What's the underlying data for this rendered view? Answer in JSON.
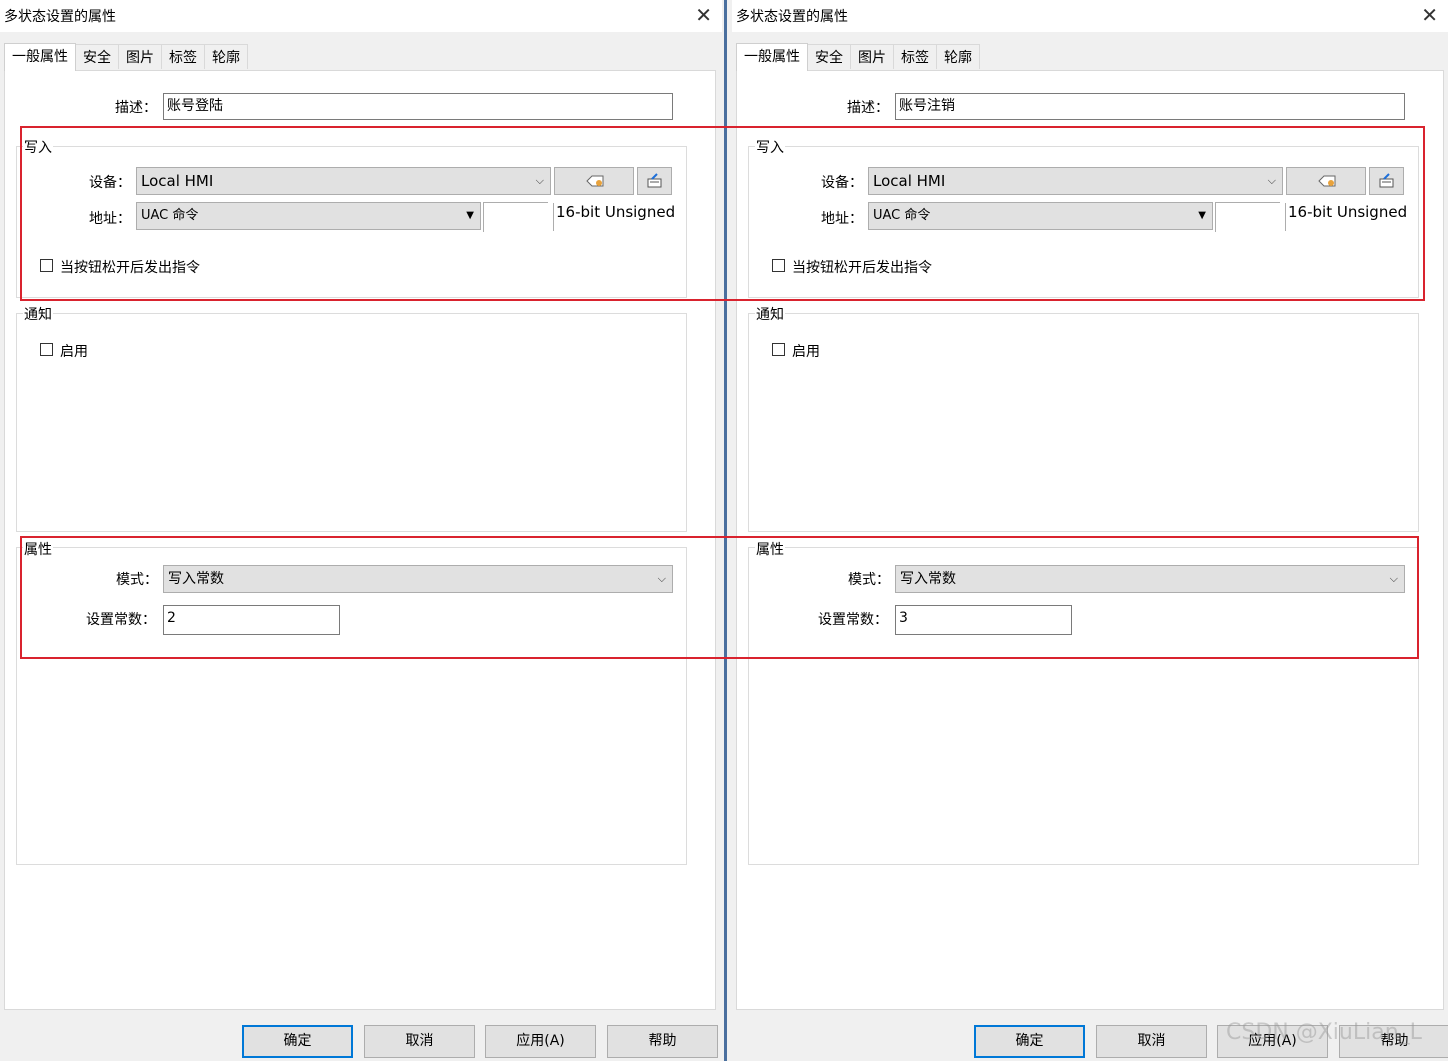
{
  "dialogs": [
    {
      "title": "多状态设置的属性",
      "tabs": [
        "一般属性",
        "安全",
        "图片",
        "标签",
        "轮廓"
      ],
      "desc_label": "描述：",
      "desc_value": "账号登陆",
      "write_group": "写入",
      "device_label": "设备：",
      "device_value": "Local HMI",
      "address_label": "地址：",
      "address_value": "UAC 命令",
      "address_offset": "",
      "data_type": "16-bit Unsigned",
      "release_checkbox": "当按钮松开后发出指令",
      "notify_group": "通知",
      "enable_checkbox": "启用",
      "attr_group": "属性",
      "mode_label": "模式：",
      "mode_value": "写入常数",
      "const_label": "设置常数：",
      "const_value": "2",
      "buttons": [
        "确定",
        "取消",
        "应用(A)",
        "帮助"
      ]
    },
    {
      "title": "多状态设置的属性",
      "tabs": [
        "一般属性",
        "安全",
        "图片",
        "标签",
        "轮廓"
      ],
      "desc_label": "描述：",
      "desc_value": "账号注销",
      "write_group": "写入",
      "device_label": "设备：",
      "device_value": "Local HMI",
      "address_label": "地址：",
      "address_value": "UAC 命令",
      "address_offset": "",
      "data_type": "16-bit Unsigned",
      "release_checkbox": "当按钮松开后发出指令",
      "notify_group": "通知",
      "enable_checkbox": "启用",
      "attr_group": "属性",
      "mode_label": "模式：",
      "mode_value": "写入常数",
      "const_label": "设置常数：",
      "const_value": "3",
      "buttons": [
        "确定",
        "取消",
        "应用(A)",
        "帮助"
      ]
    }
  ],
  "icons": {
    "close": "close-icon",
    "dropdown": "chevron-down-icon",
    "tag": "tag-icon",
    "keyboard": "keyboard-icon"
  },
  "colors": {
    "highlight": "#d9232e",
    "default_button_border": "#0078d7",
    "divider": "#4a6f9e"
  },
  "watermark": "CSDN @XiuLian_L"
}
